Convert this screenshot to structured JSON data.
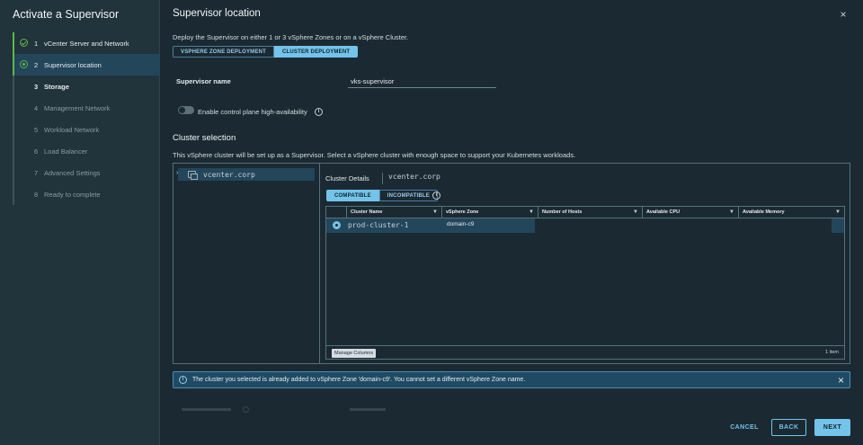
{
  "wizard": {
    "title": "Activate a Supervisor",
    "steps": [
      {
        "num": "1",
        "label": "vCenter Server and Network"
      },
      {
        "num": "2",
        "label": "Supervisor location"
      },
      {
        "num": "3",
        "label": "Storage"
      },
      {
        "num": "4",
        "label": "Management Network"
      },
      {
        "num": "5",
        "label": "Workload Network"
      },
      {
        "num": "6",
        "label": "Load Balancer"
      },
      {
        "num": "7",
        "label": "Advanced Settings"
      },
      {
        "num": "8",
        "label": "Ready to complete"
      }
    ]
  },
  "page": {
    "title": "Supervisor location",
    "close_icon": "×",
    "deploy_description": "Deploy the Supervisor on either 1 or 3 vSphere Zones or on a vSphere Cluster.",
    "deploy_options": [
      "VSPHERE ZONE DEPLOYMENT",
      "CLUSTER DEPLOYMENT"
    ],
    "deploy_selected": "CLUSTER DEPLOYMENT"
  },
  "supervisor_name": {
    "label": "Supervisor name",
    "value": "vks-supervisor"
  },
  "ha": {
    "label": "Enable control plane high-availability",
    "enabled": false,
    "info_icon": "i"
  },
  "cluster_selection": {
    "title": "Cluster selection",
    "description": "This vSphere cluster will be set up as a Supervisor. Select a vSphere cluster with enough space to support your Kubernetes workloads.",
    "tree": {
      "chevron": "›",
      "node_label": "vcenter.corp"
    },
    "details": {
      "title": "Cluster Details",
      "vcenter": "vcenter.corp",
      "filters": [
        "COMPATIBLE",
        "INCOMPATIBLE"
      ],
      "filter_selected": "COMPATIBLE",
      "columns": [
        "Cluster Name",
        "vSphere Zone",
        "Number of Hosts",
        "Available CPU",
        "Available Memory"
      ],
      "filter_icon": "▼",
      "rows": [
        {
          "cluster_name": "prod-cluster-1",
          "zone": "domain-c9",
          "hosts": "",
          "cpu": "",
          "memory": ""
        }
      ],
      "manage_columns": "Manage Columns",
      "item_count": "1 item"
    }
  },
  "alert": {
    "text": "The cluster you selected is already added to vSphere Zone 'domain-c9'. You cannot set a different vSphere Zone name.",
    "close_icon": "×",
    "info_icon": "i"
  },
  "actions": {
    "cancel": "CANCEL",
    "back": "BACK",
    "next": "NEXT"
  },
  "colors": {
    "accent": "#74c3ea",
    "success": "#5fb84a",
    "background": "#1b2a32",
    "sidebar": "#21333b",
    "selection": "#23465a",
    "alert_bg": "#1f4a64"
  }
}
